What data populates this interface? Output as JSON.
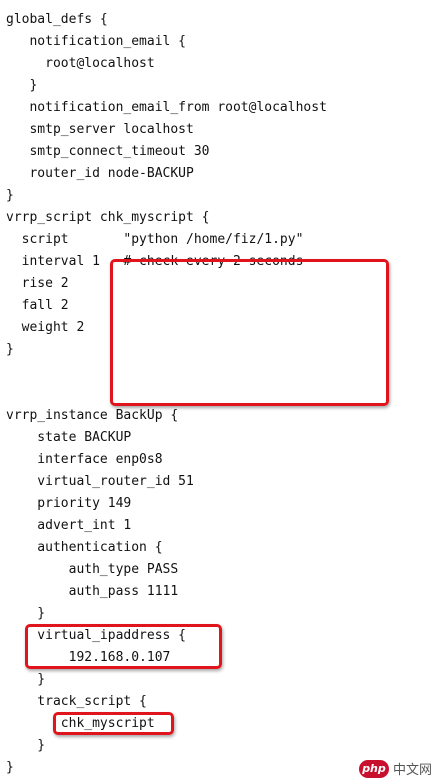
{
  "code_lines": [
    "global_defs {",
    "   notification_email {",
    "     root@localhost",
    "   }",
    "   notification_email_from root@localhost",
    "   smtp_server localhost",
    "   smtp_connect_timeout 30",
    "   router_id node-BACKUP",
    "}",
    "vrrp_script chk_myscript {",
    "  script       \"python /home/fiz/1.py\"",
    "  interval 1   # check every 2 seconds",
    "  rise 2",
    "  fall 2",
    "  weight 2",
    "}",
    "",
    "",
    "vrrp_instance BackUp {",
    "    state BACKUP",
    "    interface enp0s8",
    "    virtual_router_id 51",
    "    priority 149",
    "    advert_int 1",
    "    authentication {",
    "        auth_type PASS",
    "        auth_pass 1111",
    "    }",
    "    virtual_ipaddress {",
    "        192.168.0.107",
    "    }",
    "    track_script {",
    "       chk_myscript",
    "    }",
    "}"
  ],
  "highlight_color": "#e0141c",
  "watermark": {
    "logo": "php",
    "text": "中文网"
  }
}
